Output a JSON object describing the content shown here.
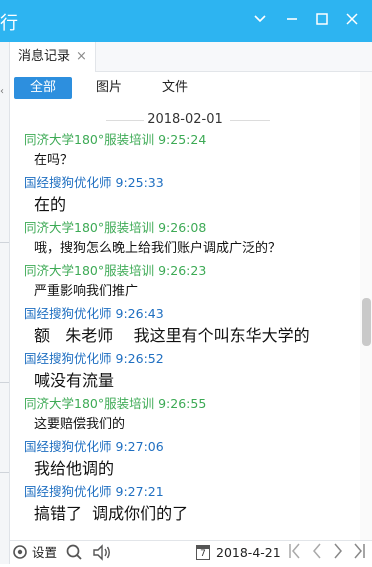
{
  "window": {
    "title_fragment": "行",
    "controls": {
      "chevron": "chevron-down-icon",
      "minimize": "minimize-icon",
      "maximize": "maximize-icon",
      "close": "close-icon"
    },
    "accent_color": "#2db4f1"
  },
  "tab": {
    "label": "消息记录",
    "close_glyph": "×"
  },
  "filters": [
    {
      "label": "全部",
      "active": true
    },
    {
      "label": "图片",
      "active": false
    },
    {
      "label": "文件",
      "active": false
    }
  ],
  "date_separator": "2018-02-01",
  "messages": [
    {
      "sender": "同济大学180°服装培训",
      "time": "9:25:24",
      "text": "在吗？",
      "sender_color": "#3daa55",
      "size": "s"
    },
    {
      "sender": "国经搜狗优化师",
      "time": "9:25:33",
      "text": "在的",
      "sender_color": "#1f6fc1",
      "size": "l"
    },
    {
      "sender": "同济大学180°服装培训",
      "time": "9:26:08",
      "text": "哦，搜狗怎么晚上给我们账户调成广泛的？",
      "sender_color": "#3daa55",
      "size": "s"
    },
    {
      "sender": "同济大学180°服装培训",
      "time": "9:26:23",
      "text": "严重影响我们推广",
      "sender_color": "#3daa55",
      "size": "s"
    },
    {
      "sender": "国经搜狗优化师",
      "time": "9:26:43",
      "text": "额   朱老师    我这里有个叫东华大学的",
      "sender_color": "#1f6fc1",
      "size": "l"
    },
    {
      "sender": "国经搜狗优化师",
      "time": "9:26:52",
      "text": "喊没有流量",
      "sender_color": "#1f6fc1",
      "size": "l"
    },
    {
      "sender": "同济大学180°服装培训",
      "time": "9:26:55",
      "text": "这要赔偿我们的",
      "sender_color": "#3daa55",
      "size": "s"
    },
    {
      "sender": "国经搜狗优化师",
      "time": "9:27:06",
      "text": "我给他调的",
      "sender_color": "#1f6fc1",
      "size": "l"
    },
    {
      "sender": "国经搜狗优化师",
      "time": "9:27:21",
      "text": "搞错了  调成你们的了",
      "sender_color": "#1f6fc1",
      "size": "l"
    }
  ],
  "bottom_bar": {
    "settings_label": "设置",
    "settings_icon": "settings-gear-icon",
    "search_icon": "search-icon",
    "speaker_icon": "speaker-icon",
    "calendar_icon": "calendar-icon",
    "calendar_glyph": "7",
    "date": "2018-4-21",
    "nav_icons": [
      "first-page-icon",
      "prev-page-icon",
      "next-page-icon",
      "last-page-icon"
    ]
  }
}
